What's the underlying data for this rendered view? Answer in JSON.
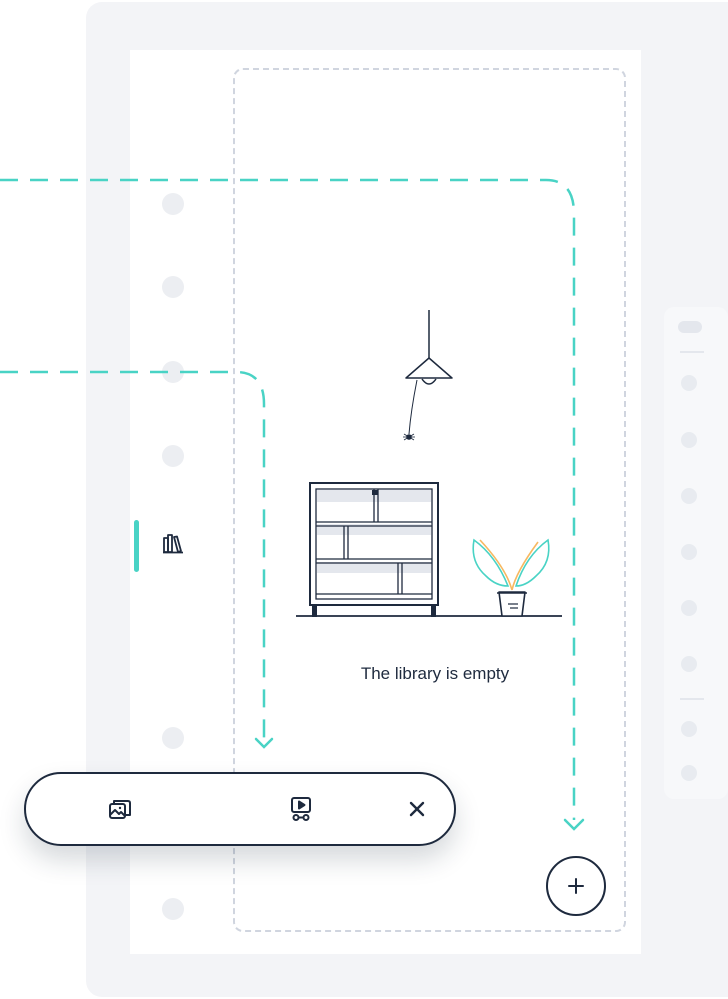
{
  "library": {
    "empty_message": "The library is empty",
    "active_nav_icon": "library-books-icon"
  },
  "toolbar": {
    "items": [
      {
        "icon": "image-gallery-icon"
      },
      {
        "icon": "video-player-icon"
      },
      {
        "icon": "close-icon"
      }
    ]
  },
  "fab": {
    "icon": "plus-icon"
  },
  "colors": {
    "accent": "#49d3c5",
    "ink": "#1e2a3e",
    "muted": "#e4e7ed",
    "plant_orange": "#f7b860"
  }
}
